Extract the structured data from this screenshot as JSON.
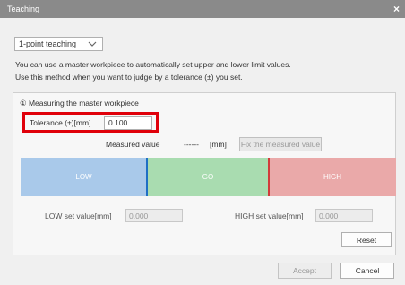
{
  "window": {
    "title": "Teaching",
    "close_glyph": "×"
  },
  "mode": {
    "selected": "1-point teaching",
    "chevron_icon": "chevron-down-icon"
  },
  "intro": {
    "line1": "You can use a master workpiece to automatically set upper and lower limit values.",
    "line2": "Use this method when you want to judge by a tolerance (±) you set."
  },
  "section": {
    "title": "① Measuring the master workpiece"
  },
  "tolerance": {
    "label": "Tolerance (±)[mm]",
    "value": "0.100",
    "highlight_color": "#e0000a"
  },
  "measured": {
    "label": "Measured value",
    "value": "------",
    "unit": "[mm]",
    "fix_button": "Fix the measured value"
  },
  "zones": {
    "low": "LOW",
    "go": "GO",
    "high": "HIGH",
    "low_color": "#a9c9ea",
    "go_color": "#a9dcb0",
    "high_color": "#eaa9a9"
  },
  "limits": {
    "low_label": "LOW set value[mm]",
    "low_value": "0.000",
    "high_label": "HIGH set value[mm]",
    "high_value": "0.000"
  },
  "buttons": {
    "reset": "Reset",
    "accept": "Accept",
    "cancel": "Cancel"
  }
}
